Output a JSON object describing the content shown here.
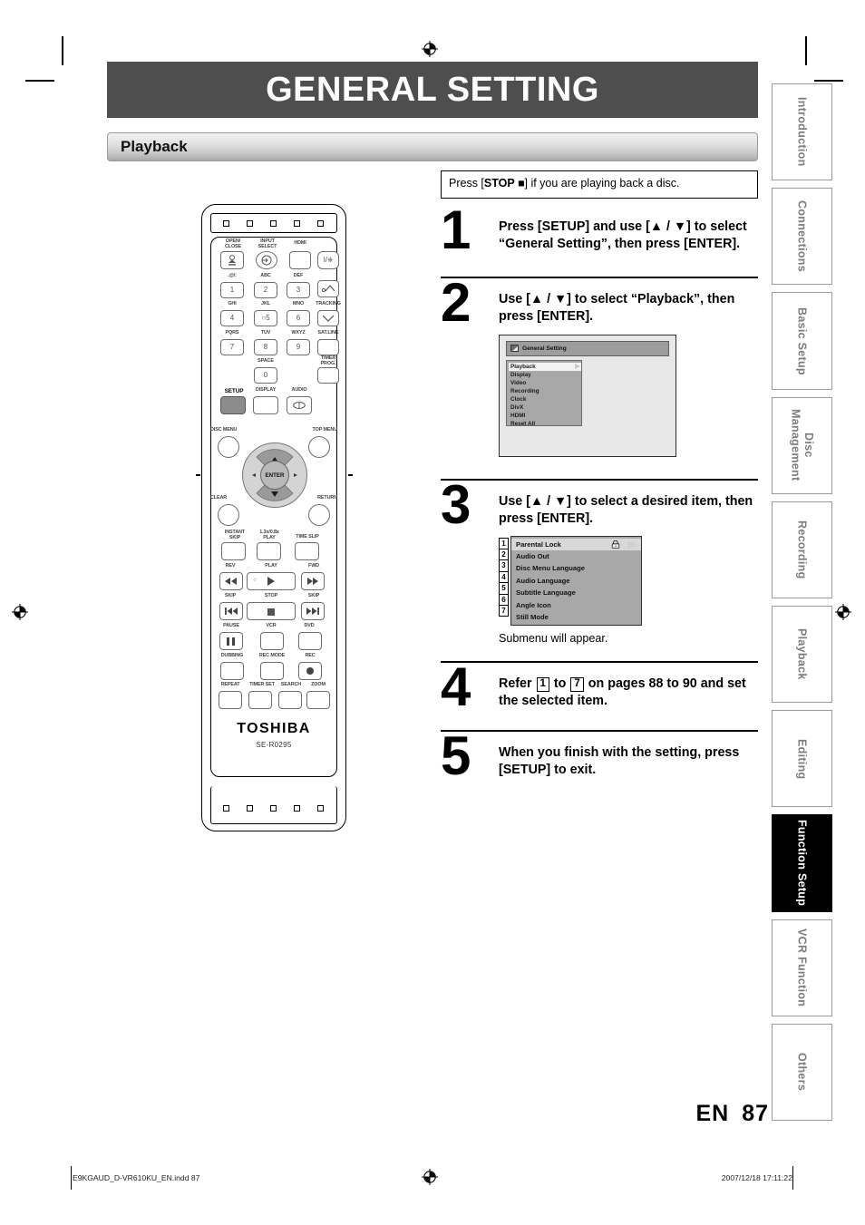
{
  "page": {
    "title": "GENERAL SETTING",
    "section": "Playback",
    "lang_code": "EN",
    "page_number": "87"
  },
  "footer": {
    "file": "E9KGAUD_D-VR610KU_EN.indd   87",
    "timestamp": "2007/12/18   17:11:22"
  },
  "side_tabs": [
    {
      "label": "Introduction",
      "active": false
    },
    {
      "label": "Connections",
      "active": false
    },
    {
      "label": "Basic Setup",
      "active": false
    },
    {
      "label": "Disc\nManagement",
      "active": false
    },
    {
      "label": "Recording",
      "active": false
    },
    {
      "label": "Playback",
      "active": false
    },
    {
      "label": "Editing",
      "active": false
    },
    {
      "label": "Function Setup",
      "active": true
    },
    {
      "label": "VCR Function",
      "active": false
    },
    {
      "label": "Others",
      "active": false
    }
  ],
  "note": {
    "prefix": "Press [",
    "bold": "STOP ■",
    "suffix": "] if you are playing back a disc."
  },
  "steps": [
    {
      "number": "1",
      "text": "Press [SETUP] and use [▲ / ▼] to select “General Setting”, then press [ENTER]."
    },
    {
      "number": "2",
      "text": "Use [▲ / ▼] to select “Playback”, then press [ENTER]."
    },
    {
      "number": "3",
      "text": "Use [▲ / ▼] to select a desired item, then press [ENTER].",
      "sub": "Submenu will appear."
    },
    {
      "number": "4",
      "text_pre": "Refer ",
      "box_a": "1",
      "text_mid": " to ",
      "box_b": "7",
      "text_post": " on pages 88 to 90 and set the selected item."
    },
    {
      "number": "5",
      "text": "When you finish with the setting, press [SETUP] to exit."
    }
  ],
  "osd_general_setting": {
    "title": "General Setting",
    "items": [
      {
        "label": "Playback",
        "selected": true
      },
      {
        "label": "Display",
        "selected": false
      },
      {
        "label": "Video",
        "selected": false
      },
      {
        "label": "Recording",
        "selected": false
      },
      {
        "label": "Clock",
        "selected": false
      },
      {
        "label": "DivX",
        "selected": false
      },
      {
        "label": "HDMI",
        "selected": false
      },
      {
        "label": "Reset All",
        "selected": false
      }
    ]
  },
  "osd_playback_submenu": {
    "items": [
      {
        "num": "1",
        "label": "Parental Lock",
        "icon": "padlock-icon",
        "arrow": true
      },
      {
        "num": "2",
        "label": "Audio Out",
        "icon": null,
        "arrow": false
      },
      {
        "num": "3",
        "label": "Disc Menu Language",
        "icon": null,
        "arrow": false
      },
      {
        "num": "4",
        "label": "Audio Language",
        "icon": null,
        "arrow": false
      },
      {
        "num": "5",
        "label": "Subtitle Language",
        "icon": null,
        "arrow": false
      },
      {
        "num": "6",
        "label": "Angle Icon",
        "icon": null,
        "arrow": false
      },
      {
        "num": "7",
        "label": "Still Mode",
        "icon": null,
        "arrow": false
      }
    ]
  },
  "remote": {
    "brand": "TOSHIBA",
    "model": "SE-R0295",
    "buttons": [
      {
        "label": "OPEN/\nCLOSE",
        "glyph": "eject-icon"
      },
      {
        "label": "INPUT\nSELECT",
        "glyph": "input-select-icon"
      },
      {
        "label": "HDMI",
        "glyph": null
      },
      {
        "label": "",
        "glyph": "power-icon"
      },
      {
        "label": ".@/:",
        "glyph": "1"
      },
      {
        "label": "ABC",
        "glyph": "2"
      },
      {
        "label": "DEF",
        "glyph": "3"
      },
      {
        "label": "",
        "glyph": "tracking-up-icon"
      },
      {
        "label": "GHI",
        "glyph": "4"
      },
      {
        "label": "JKL",
        "glyph": "5"
      },
      {
        "label": "MNO",
        "glyph": "6"
      },
      {
        "label": "TRACKING",
        "glyph": "tracking-down-icon"
      },
      {
        "label": "PQRS",
        "glyph": "7"
      },
      {
        "label": "TUV",
        "glyph": "8"
      },
      {
        "label": "WXYZ",
        "glyph": "9"
      },
      {
        "label": "SAT.LINK",
        "glyph": null
      },
      {
        "label": "SPACE",
        "glyph": "0"
      },
      {
        "label": "TIMER\nPROG.",
        "glyph": null
      },
      {
        "label": "SETUP",
        "glyph": null,
        "highlighted": true
      },
      {
        "label": "DISPLAY",
        "glyph": null
      },
      {
        "label": "AUDIO",
        "glyph": "audio-icon"
      },
      {
        "label": "DISC MENU",
        "glyph": null
      },
      {
        "label": "TOP MENU",
        "glyph": null
      },
      {
        "label": "CLEAR",
        "glyph": null
      },
      {
        "label": "RETURN",
        "glyph": null
      },
      {
        "label": "ENTER",
        "glyph": null
      },
      {
        "label": "INSTANT\nSKIP",
        "glyph": null
      },
      {
        "label": "1.3x/0.8x\nPLAY",
        "glyph": null
      },
      {
        "label": "TIME SLIP",
        "glyph": null
      },
      {
        "label": "REV",
        "glyph": "rewind-icon"
      },
      {
        "label": "PLAY",
        "glyph": "play-icon"
      },
      {
        "label": "FWD",
        "glyph": "fast-forward-icon"
      },
      {
        "label": "SKIP",
        "glyph": "skip-previous-icon"
      },
      {
        "label": "STOP",
        "glyph": "stop-icon"
      },
      {
        "label": "SKIP",
        "glyph": "skip-next-icon"
      },
      {
        "label": "PAUSE",
        "glyph": "pause-icon"
      },
      {
        "label": "VCR",
        "glyph": null
      },
      {
        "label": "DVD",
        "glyph": null
      },
      {
        "label": "DUBBING",
        "glyph": null
      },
      {
        "label": "REC MODE",
        "glyph": null
      },
      {
        "label": "REC",
        "glyph": "record-icon"
      },
      {
        "label": "REPEAT",
        "glyph": null
      },
      {
        "label": "TIMER SET",
        "glyph": null
      },
      {
        "label": "SEARCH",
        "glyph": null
      },
      {
        "label": "ZOOM",
        "glyph": null
      }
    ]
  }
}
